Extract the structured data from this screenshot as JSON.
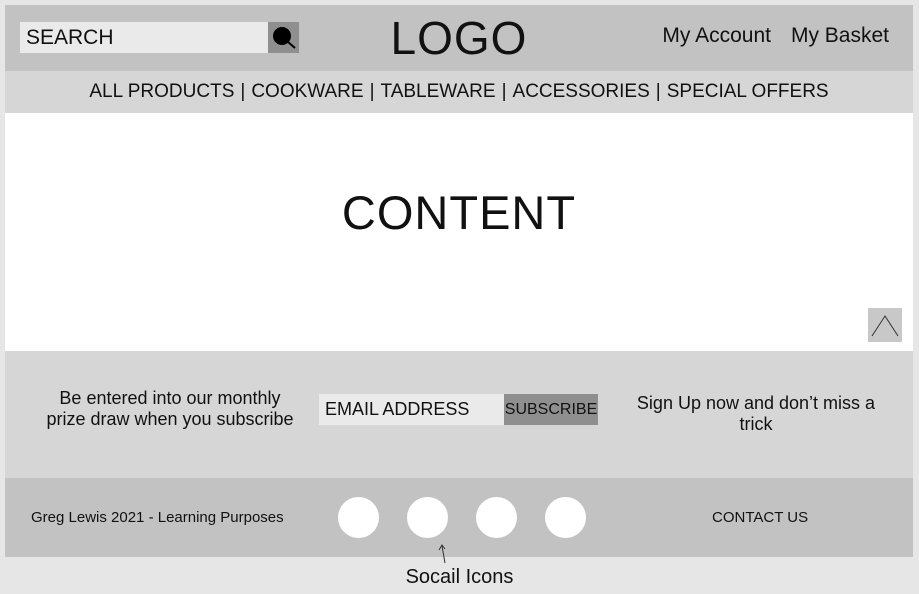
{
  "header": {
    "search": {
      "placeholder": "SEARCH"
    },
    "logo": "LOGO",
    "account_links": [
      "My Account",
      "My Basket"
    ]
  },
  "nav": {
    "items": [
      "ALL PRODUCTS",
      "COOKWARE",
      "TABLEWARE",
      "ACCESSORIES",
      "SPECIAL OFFERS"
    ],
    "separator": "|"
  },
  "content": {
    "title": "CONTENT"
  },
  "subscribe": {
    "promo_left": "Be entered into our monthly prize draw when you subscribe",
    "email_placeholder": "EMAIL ADDRESS",
    "button_label": "SUBSCRIBE",
    "promo_right": "Sign Up now and don’t miss a trick"
  },
  "footer": {
    "copyright": "Greg Lewis 2021 - Learning Purposes",
    "social_icons": [
      "social-icon-1",
      "social-icon-2",
      "social-icon-3",
      "social-icon-4"
    ],
    "contact_label": "CONTACT US"
  },
  "annotation": {
    "label": "Socail Icons"
  },
  "colors": {
    "header_bg": "#c2c2c2",
    "nav_bg": "#d6d6d6",
    "content_bg": "#ffffff",
    "button_bg": "#8f8f8f",
    "input_bg": "#eaeaea",
    "page_bg": "#e6e6e6"
  }
}
